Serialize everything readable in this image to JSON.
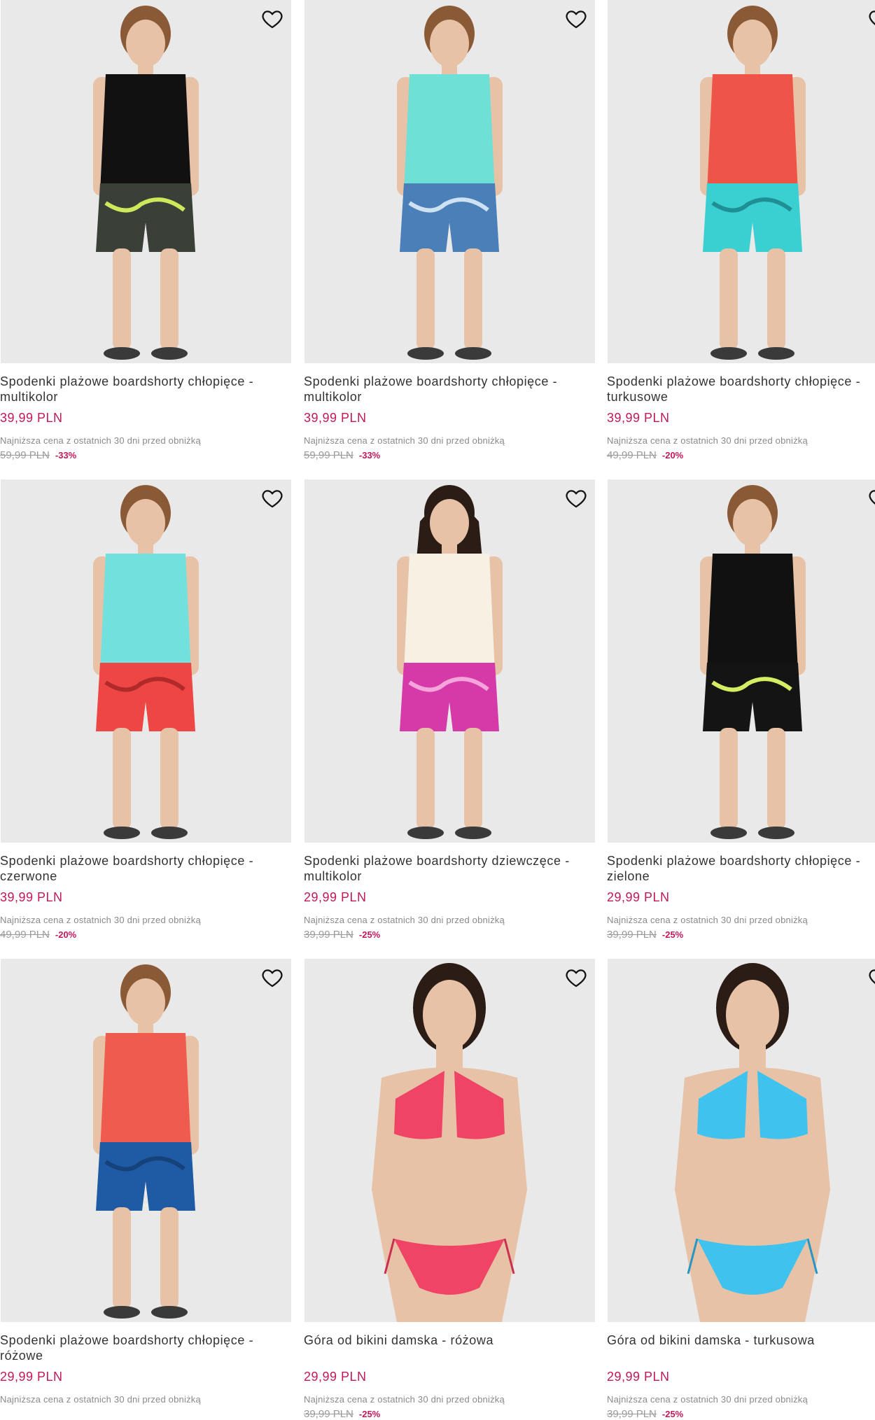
{
  "colors": {
    "price": "#c2185b",
    "photo_bg": "#e9e9e9",
    "old_price": "#9a9a9a"
  },
  "icons": {
    "wishlist": "heart-outline-icon"
  },
  "products": [
    {
      "title": "Spodenki plażowe boardshorty chłopięce - multikolor",
      "price": "39,99 PLN",
      "lowest_label": "Najniższa cena z ostatnich 30 dni przed obniżką",
      "old_price": "59,99 PLN",
      "discount": "-33%",
      "top_color": "#111111",
      "bottom_color": "#3a3f38",
      "bottom_accent": "#cde85a",
      "kind": "boy"
    },
    {
      "title": "Spodenki plażowe boardshorty chłopięce - multikolor",
      "price": "39,99 PLN",
      "lowest_label": "Najniższa cena z ostatnich 30 dni przed obniżką",
      "old_price": "59,99 PLN",
      "discount": "-33%",
      "top_color": "#6fe0d6",
      "bottom_color": "#4a7fb8",
      "bottom_accent": "#cfe2f3",
      "kind": "boy"
    },
    {
      "title": "Spodenki plażowe boardshorty chłopięce - turkusowe",
      "price": "39,99 PLN",
      "lowest_label": "Najniższa cena z ostatnich 30 dni przed obniżką",
      "old_price": "49,99 PLN",
      "discount": "-20%",
      "top_color": "#ef5448",
      "bottom_color": "#3ad0d2",
      "bottom_accent": "#1f8f95",
      "kind": "boy"
    },
    {
      "title": "Spodenki plażowe boardshorty chłopięce - czerwone",
      "price": "39,99 PLN",
      "lowest_label": "Najniższa cena z ostatnich 30 dni przed obniżką",
      "old_price": "49,99 PLN",
      "discount": "-20%",
      "top_color": "#72e0dd",
      "bottom_color": "#ee4545",
      "bottom_accent": "#b02a2a",
      "kind": "boy"
    },
    {
      "title": "Spodenki plażowe boardshorty dziewczęce - multikolor",
      "price": "29,99 PLN",
      "lowest_label": "Najniższa cena z ostatnich 30 dni przed obniżką",
      "old_price": "39,99 PLN",
      "discount": "-25%",
      "top_color": "#f6f1e3",
      "bottom_color": "#d63aa8",
      "bottom_accent": "#f5a5dc",
      "kind": "girl"
    },
    {
      "title": "Spodenki plażowe boardshorty chłopięce - zielone",
      "price": "29,99 PLN",
      "lowest_label": "Najniższa cena z ostatnich 30 dni przed obniżką",
      "old_price": "39,99 PLN",
      "discount": "-25%",
      "top_color": "#111111",
      "bottom_color": "#141414",
      "bottom_accent": "#d3ee63",
      "kind": "boy"
    },
    {
      "title": "Spodenki plażowe boardshorty chłopięce - różowe",
      "price": "29,99 PLN",
      "lowest_label": "Najniższa cena z ostatnich 30 dni przed obniżką",
      "old_price": "",
      "discount": "",
      "top_color": "#ef5b4e",
      "bottom_color": "#1f5aa5",
      "bottom_accent": "#16427a",
      "kind": "boy"
    },
    {
      "title": "Góra od bikini damska - różowa",
      "price": "29,99 PLN",
      "lowest_label": "Najniższa cena z ostatnich 30 dni przed obniżką",
      "old_price": "39,99 PLN",
      "discount": "-25%",
      "top_color": "#ef4466",
      "bottom_color": "#ef4466",
      "bottom_accent": "#c9304f",
      "kind": "woman"
    },
    {
      "title": "Góra od bikini damska - turkusowa",
      "price": "29,99 PLN",
      "lowest_label": "Najniższa cena z ostatnich 30 dni przed obniżką",
      "old_price": "39,99 PLN",
      "discount": "-25%",
      "top_color": "#3fc3ee",
      "bottom_color": "#3fc3ee",
      "bottom_accent": "#2796c0",
      "kind": "woman"
    }
  ]
}
